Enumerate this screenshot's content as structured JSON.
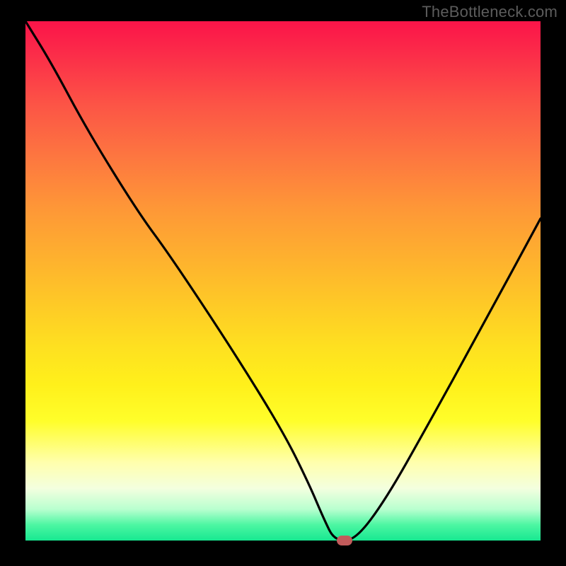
{
  "watermark": "TheBottleneck.com",
  "chart_data": {
    "type": "line",
    "title": "",
    "xlabel": "",
    "ylabel": "",
    "xlim": [
      0,
      100
    ],
    "ylim": [
      0,
      100
    ],
    "grid": false,
    "legend": false,
    "series": [
      {
        "name": "bottleneck-curve",
        "x": [
          0,
          5,
          12,
          22,
          28,
          40,
          50,
          55,
          58,
          60,
          64,
          70,
          78,
          88,
          100
        ],
        "y": [
          100,
          92,
          79,
          63,
          55,
          37,
          21,
          11,
          4,
          0,
          0,
          8,
          22,
          40,
          62
        ]
      }
    ],
    "marker": {
      "x": 62,
      "y": 0,
      "color": "#c25b5b"
    },
    "background_gradient": {
      "stops": [
        {
          "pos": 0,
          "color": "#fb1449"
        },
        {
          "pos": 16,
          "color": "#fc5446"
        },
        {
          "pos": 36,
          "color": "#fe9737"
        },
        {
          "pos": 55,
          "color": "#fecb26"
        },
        {
          "pos": 77,
          "color": "#fffe2a"
        },
        {
          "pos": 90,
          "color": "#f3ffdf"
        },
        {
          "pos": 100,
          "color": "#17e891"
        }
      ]
    }
  }
}
